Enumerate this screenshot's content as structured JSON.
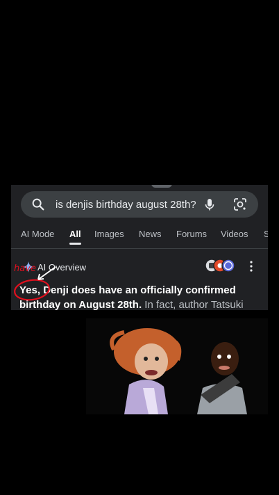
{
  "search": {
    "query": "is denjis birthday august 28th?"
  },
  "tabs": [
    {
      "label": "AI Mode"
    },
    {
      "label": "All"
    },
    {
      "label": "Images"
    },
    {
      "label": "News"
    },
    {
      "label": "Forums"
    },
    {
      "label": "Videos"
    },
    {
      "label": "S"
    }
  ],
  "ai_overview": {
    "title": "AI Overview",
    "answer_bold_1": "Yes, Denji does have an officially confirmed birthday on August 28th.",
    "answer_rest": " In fact, author Tatsuki"
  },
  "annotation": {
    "handwritten": "have"
  },
  "colors": {
    "background": "#000000",
    "panel": "#202124",
    "search_bar": "#3c4043",
    "annotation_red": "#e0101e"
  }
}
